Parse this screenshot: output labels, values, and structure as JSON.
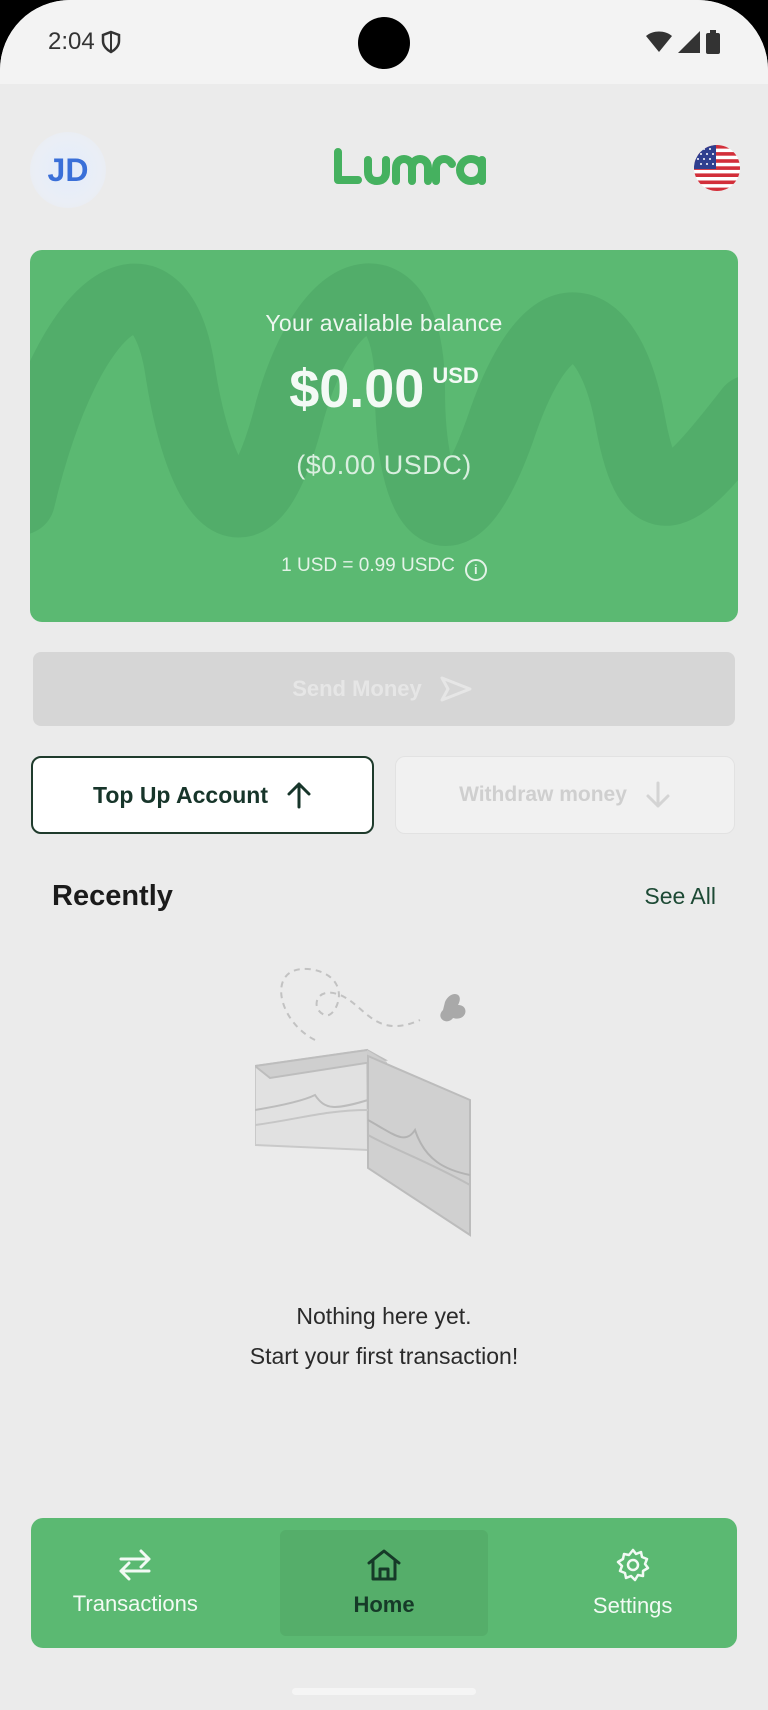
{
  "status_bar": {
    "time": "2:04"
  },
  "header": {
    "avatar_initials": "JD",
    "logo_text": "Luma",
    "country_flag": "us-flag-icon"
  },
  "balance": {
    "label": "Your available balance",
    "amount": "$0.00",
    "currency": "USD",
    "usdc_amount": "($0.00 USDC)",
    "rate": "1 USD = 0.99 USDC"
  },
  "actions": {
    "send_label": "Send Money",
    "topup_label": "Top Up Account",
    "withdraw_label": "Withdraw money"
  },
  "recent": {
    "title": "Recently",
    "see_all": "See All",
    "empty_line1": "Nothing here yet.",
    "empty_line2": "Start your first transaction!"
  },
  "nav": {
    "items": [
      {
        "label": "Transactions",
        "icon": "transfer-arrows-icon"
      },
      {
        "label": "Home",
        "icon": "home-icon"
      },
      {
        "label": "Settings",
        "icon": "gear-icon"
      }
    ]
  },
  "colors": {
    "brand_green": "#5bb972",
    "dark_green": "#17352a",
    "avatar_blue": "#3a6fd8"
  }
}
